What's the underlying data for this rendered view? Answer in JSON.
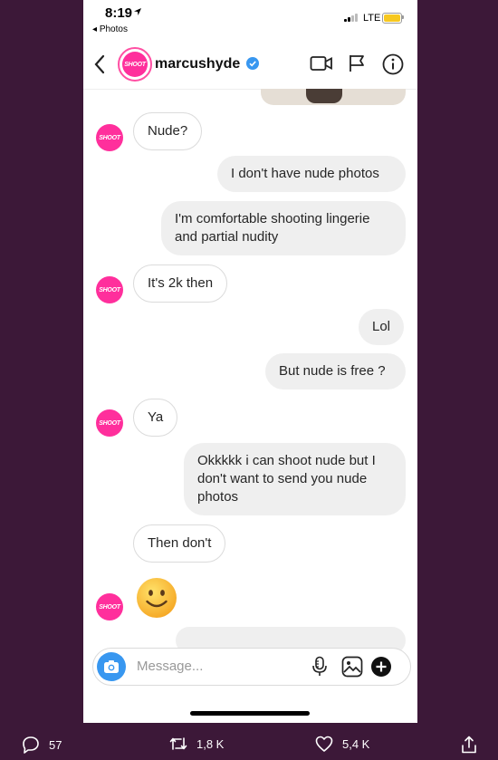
{
  "status_bar": {
    "time": "8:19",
    "back_app": "Photos",
    "network": "LTE"
  },
  "header": {
    "username": "marcushyde"
  },
  "avatar_text": "SHOOT",
  "messages": [
    {
      "side": "in",
      "text": "Nude?"
    },
    {
      "side": "out",
      "text": "I don't have nude photos"
    },
    {
      "side": "out",
      "text": "I'm comfortable shooting lingerie and partial nudity"
    },
    {
      "side": "in",
      "text": "It's 2k then"
    },
    {
      "side": "out",
      "text": "Lol"
    },
    {
      "side": "out",
      "text": "But nude is free ?"
    },
    {
      "side": "in",
      "text": "Ya"
    },
    {
      "side": "out",
      "text": "Okkkkk i can shoot nude but I don't want to send you nude photos"
    },
    {
      "side": "in",
      "text": "Then don't"
    },
    {
      "side": "in",
      "emoji": "slightly-smiling-face"
    }
  ],
  "composer": {
    "placeholder": "Message..."
  },
  "tweet_actions": {
    "replies": "57",
    "retweets": "1,8 K",
    "likes": "5,4 K"
  },
  "colors": {
    "background": "#3c1838",
    "accent_pink": "#ff2f9c",
    "verified_blue": "#3897f0"
  }
}
